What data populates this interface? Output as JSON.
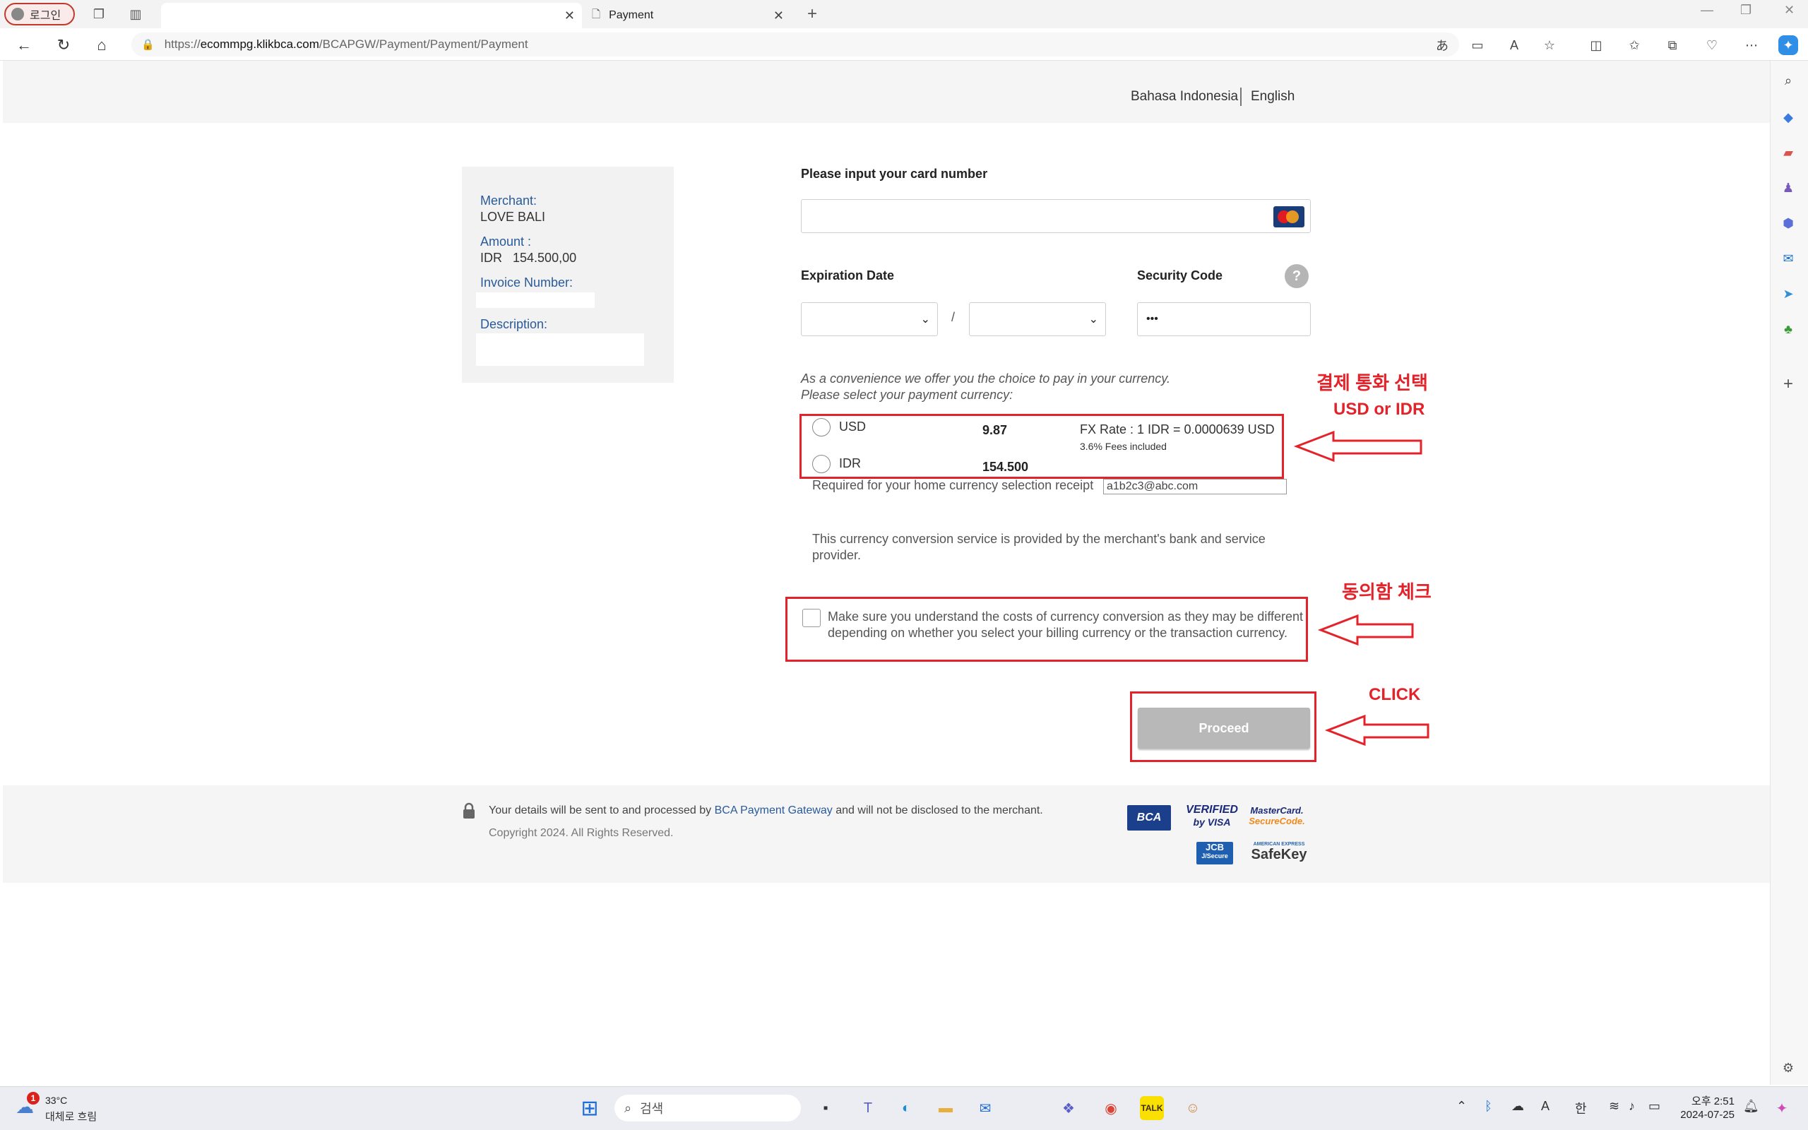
{
  "browser": {
    "profile_label": "로그인",
    "tabs": [
      {
        "label": ""
      },
      {
        "label": "Payment"
      }
    ],
    "new_tab_icon": "plus-icon",
    "url_prefix": "https://",
    "url_host": "ecommpg.klikbca.com",
    "url_path": "/BCAPGW/Payment/Payment/Payment"
  },
  "header": {
    "lang_id": "Bahasa Indonesia",
    "lang_en": "English"
  },
  "info": {
    "merchant_label": "Merchant:",
    "merchant_value": "LOVE BALI",
    "amount_label": "Amount :",
    "amount_currency": "IDR",
    "amount_value": "154.500,00",
    "invoice_label": "Invoice Number:",
    "description_label": "Description:"
  },
  "form": {
    "card_label": "Please input your card number",
    "card_value": "",
    "expiry_label": "Expiration Date",
    "expiry_sep": "/",
    "security_label": "Security Code",
    "security_value": "•••",
    "help_icon": "?",
    "currency_intro_1": "As a convenience we offer you the choice to pay in your currency.",
    "currency_intro_2": "Please select your payment currency:",
    "usd_label": "USD",
    "usd_amount": "9.87",
    "fx_rate": "FX Rate : 1 IDR = 0.0000639 USD",
    "fees_note": "3.6% Fees included",
    "idr_label": "IDR",
    "idr_amount": "154.500",
    "receipt_label": "Required for your home currency selection receipt",
    "receipt_email": "a1b2c3@abc.com",
    "service_note": "This currency conversion service is provided by the merchant's bank and service provider.",
    "agree_text": "Make sure you understand the costs of currency conversion as they may be different depending on whether you select your billing currency or the transaction currency.",
    "proceed_label": "Proceed"
  },
  "annotations": {
    "currency_title": "결제 통화 선택",
    "currency_sub": "USD or IDR",
    "agree_title": "동의함 체크",
    "click_title": "CLICK",
    "color": "#e4222a"
  },
  "footer": {
    "text_before": "Your details will be sent to and processed by",
    "link": "BCA Payment Gateway",
    "text_after": "and will not be disclosed to the merchant.",
    "copyright": "Copyright 2024. All Rights Reserved.",
    "badges": {
      "bca": "BCA",
      "visa_1": "VERIFIED",
      "visa_2": "by VISA",
      "mc_1": "MasterCard.",
      "mc_2": "SecureCode.",
      "jcb_1": "JCB",
      "jcb_2": "J/Secure",
      "amex_1": "AMERICAN EXPRESS",
      "amex_2": "SafeKey"
    }
  },
  "taskbar": {
    "weather_temp": "33°C",
    "weather_desc": "대체로 흐림",
    "weather_badge": "1",
    "search_placeholder": "검색",
    "ime_1": "A",
    "ime_2": "한",
    "time": "오후 2:51",
    "date": "2024-07-25"
  }
}
